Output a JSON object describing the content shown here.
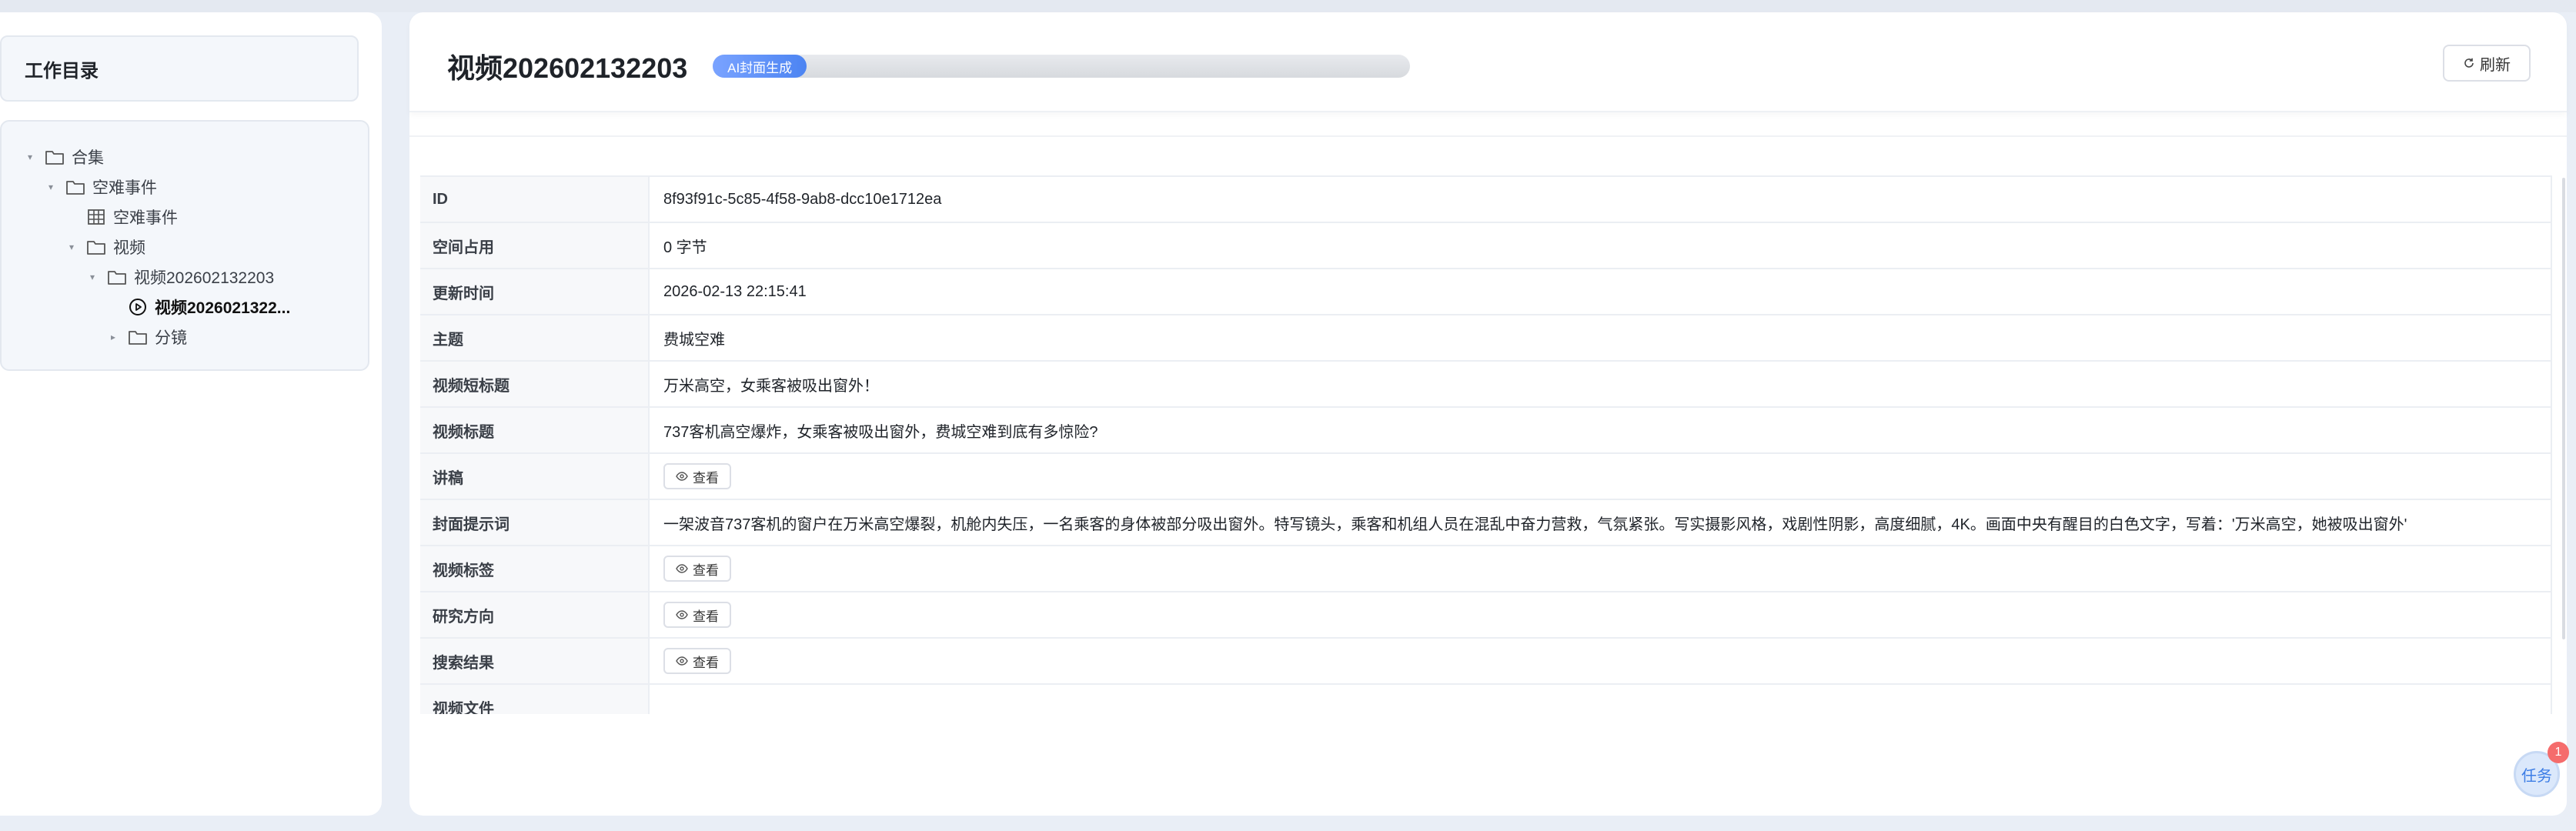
{
  "sidebar": {
    "title": "工作目录",
    "tree": [
      {
        "label": "合集",
        "icon": "folder-icon",
        "caret": "down",
        "indent": 0
      },
      {
        "label": "空难事件",
        "icon": "folder-icon",
        "caret": "down",
        "indent": 1
      },
      {
        "label": "空难事件",
        "icon": "table-icon",
        "caret": "none",
        "indent": 2
      },
      {
        "label": "视频",
        "icon": "folder-icon",
        "caret": "down",
        "indent": 2
      },
      {
        "label": "视频202602132203",
        "icon": "folder-icon",
        "caret": "down",
        "indent": 3
      },
      {
        "label": "视频2026021322...",
        "icon": "play-circle-icon",
        "caret": "none",
        "indent": 4,
        "active": true
      },
      {
        "label": "分镜",
        "icon": "folder-icon",
        "caret": "right",
        "indent": 4
      }
    ]
  },
  "header": {
    "title": "视频202602132203",
    "progress_label": "AI封面生成",
    "progress_fraction": 0.063,
    "refresh_label": "刷新"
  },
  "details": {
    "view_label": "查看",
    "rows": [
      {
        "label": "ID",
        "value": "8f93f91c-5c85-4f58-9ab8-dcc10e1712ea"
      },
      {
        "label": "空间占用",
        "value": "0 字节"
      },
      {
        "label": "更新时间",
        "value": "2026-02-13 22:15:41"
      },
      {
        "label": "主题",
        "value": "费城空难"
      },
      {
        "label": "视频短标题",
        "value": "万米高空，女乘客被吸出窗外！"
      },
      {
        "label": "视频标题",
        "value": "737客机高空爆炸，女乘客被吸出窗外，费城空难到底有多惊险?"
      },
      {
        "label": "讲稿",
        "value": null
      },
      {
        "label": "封面提示词",
        "value": "一架波音737客机的窗户在万米高空爆裂，机舱内失压，一名乘客的身体被部分吸出窗外。特写镜头，乘客和机组人员在混乱中奋力营救，气氛紧张。写实摄影风格，戏剧性阴影，高度细腻，4K。画面中央有醒目的白色文字，写着：'万米高空，她被吸出窗外'"
      },
      {
        "label": "视频标签",
        "value": null
      },
      {
        "label": "研究方向",
        "value": null
      },
      {
        "label": "搜索结果",
        "value": null
      },
      {
        "label": "视频文件",
        "value": ""
      }
    ]
  },
  "task": {
    "label": "任务",
    "badge": "1"
  },
  "colors": {
    "accent": "#4c84f2",
    "badge": "#f56c6c",
    "background": "#e9eef6"
  }
}
